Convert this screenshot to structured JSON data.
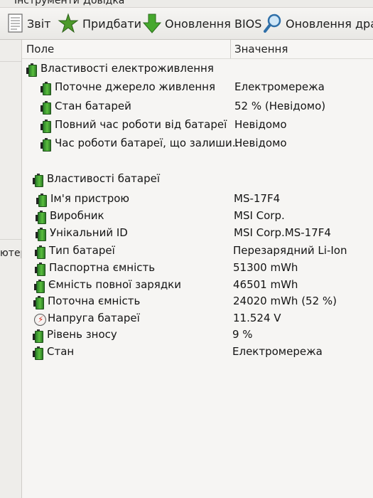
{
  "menu": {
    "items": [
      "Інструменти",
      "Довідка"
    ]
  },
  "toolbar": {
    "report_label": "Звіт",
    "buy_label": "Придбати",
    "bios_update_label": "Оновлення BIOS",
    "driver_update_label": "Оновлення драй"
  },
  "left_pane": {
    "partial_text": "ютер"
  },
  "columns": {
    "field": "Поле",
    "value": "Значення"
  },
  "groups": [
    {
      "title": "Властивості електроживлення",
      "rows": [
        {
          "field": "Поточне джерело живлення",
          "value": "Електромережа",
          "icon": "battery-icon"
        },
        {
          "field": "Стан батарей",
          "value": "52 % (Невідомо)",
          "icon": "battery-icon"
        },
        {
          "field": "Повний час роботи від батареї",
          "value": "Невідомо",
          "icon": "battery-icon"
        },
        {
          "field": "Час роботи батареї, що залиши...",
          "value": "Невідомо",
          "icon": "battery-icon"
        }
      ]
    },
    {
      "title": "Властивості батареї",
      "rows": [
        {
          "field": "Ім'я пристрою",
          "value": "MS-17F4",
          "icon": "battery-icon"
        },
        {
          "field": "Виробник",
          "value": "MSI Corp.",
          "icon": "battery-icon"
        },
        {
          "field": "Унікальний ID",
          "value": "MSI Corp.MS-17F4",
          "icon": "battery-icon"
        },
        {
          "field": "Тип батареї",
          "value": "Перезарядний Li-Ion",
          "icon": "battery-icon"
        },
        {
          "field": "Паспортна ємність",
          "value": "51300 mWh",
          "icon": "battery-icon"
        },
        {
          "field": "Ємність повної зарядки",
          "value": "46501 mWh",
          "icon": "battery-icon"
        },
        {
          "field": "Поточна ємність",
          "value": "24020 mWh  (52 %)",
          "icon": "battery-icon"
        },
        {
          "field": "Напруга батареї",
          "value": "11.524 V",
          "icon": "voltage-icon"
        },
        {
          "field": "Рівень зносу",
          "value": "9 %",
          "icon": "battery-icon"
        },
        {
          "field": "Стан",
          "value": "Електромережа",
          "icon": "battery-icon"
        }
      ]
    }
  ],
  "colors": {
    "battery_green": "#3fa63a",
    "bolt_red": "#d12a1a",
    "background": "#f6f5f3"
  }
}
